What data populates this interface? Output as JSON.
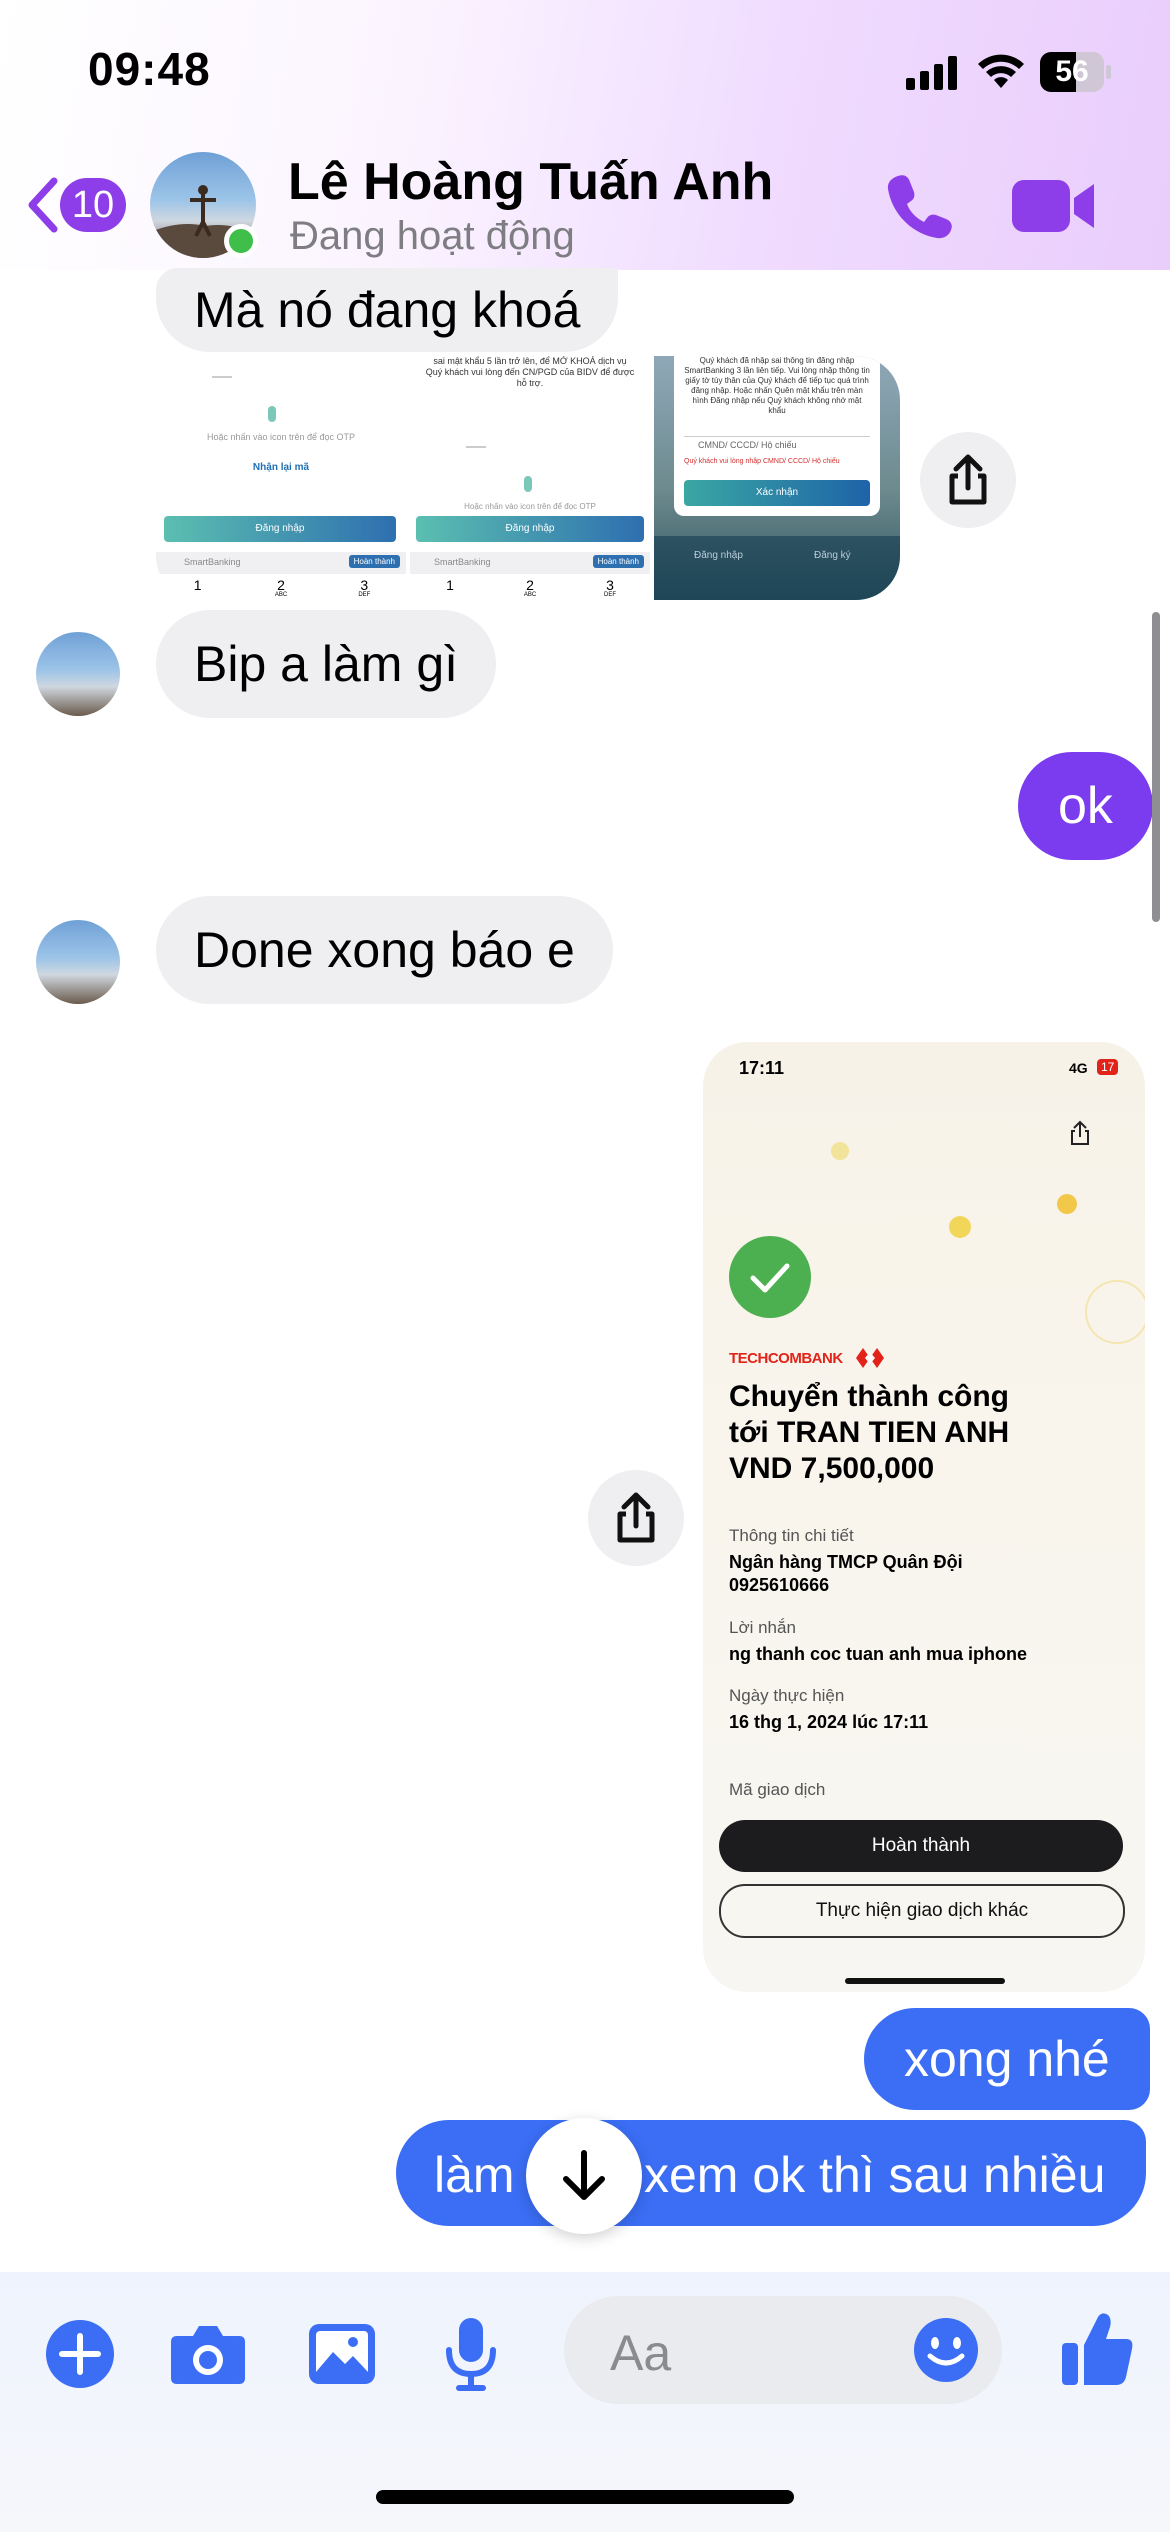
{
  "status_bar": {
    "time": "09:48",
    "battery": "56"
  },
  "header": {
    "back_count": "10",
    "contact_name": "Lê Hoàng Tuấn Anh",
    "presence": "Đang hoạt động",
    "accent_color": "#8e3ee8"
  },
  "messages": {
    "m1": "Mà nó đang khoá",
    "m2": "Bip a làm gì",
    "m3": "ok",
    "m4": "Done xong báo e",
    "m5": "xong nhé",
    "m6_part1": "làm",
    "m6_part2": "xem ok thì sau nhiều"
  },
  "screenshot_thumbs": {
    "t1": {
      "otp_hint": "Hoặc nhấn vào icon trên để đọc OTP",
      "resend": "Nhận lại mã",
      "login": "Đăng nhập",
      "smartbanking": "SmartBanking",
      "done": "Hoàn thành",
      "keys": [
        "1",
        "2",
        "3"
      ],
      "key_letters": [
        "",
        "ABC",
        "DEF"
      ]
    },
    "t2": {
      "notice": "sai mật khẩu 5 lần trở lên, để MỞ KHOÁ dịch vụ Quý khách vui lòng đến CN/PGD của BIDV để được hỗ trợ.",
      "otp_hint": "Hoặc nhấn vào icon trên để đọc OTP",
      "login": "Đăng nhập",
      "smartbanking": "SmartBanking",
      "done": "Hoàn thành",
      "keys": [
        "1",
        "2",
        "3"
      ],
      "key_letters": [
        "",
        "ABC",
        "DEF"
      ]
    },
    "t3": {
      "notice": "Quý khách đã nhập sai thông tin đăng nhập SmartBanking 3 lần liên tiếp. Vui lòng nhập thông tin giấy tờ tùy thân của Quý khách để tiếp tục quá trình đăng nhập. Hoặc nhấn Quên mật khẩu trên màn hình Đăng nhập nếu Quý khách không nhớ mật khẩu",
      "id_placeholder": "CMND/ CCCD/ Hộ chiếu",
      "error": "Quý khách vui lòng nhập CMND/ CCCD/ Hộ chiếu",
      "confirm": "Xác nhận",
      "login": "Đăng nhập",
      "register": "Đăng ký"
    }
  },
  "receipt": {
    "time": "17:11",
    "network": "4G",
    "battery": "17",
    "bank": "TECHCOMBANK",
    "headline": [
      "Chuyển thành công",
      "tới TRAN TIEN ANH",
      "VND 7,500,000"
    ],
    "details_label": "Thông tin chi tiết",
    "bank_name": "Ngân hàng TMCP Quân Đội",
    "account": "0925610666",
    "message_label": "Lời nhắn",
    "message": "ng thanh coc tuan anh mua iphone",
    "date_label": "Ngày thực hiện",
    "date": "16 thg 1, 2024 lúc 17:11",
    "txn_label": "Mã giao dịch",
    "done_button": "Hoàn thành",
    "other_button": "Thực hiện giao dịch khác"
  },
  "composer": {
    "placeholder": "Aa",
    "icons": [
      "plus-icon",
      "camera-icon",
      "gallery-icon",
      "microphone-icon",
      "emoji-icon",
      "thumbs-up-icon"
    ]
  },
  "colors": {
    "outgoing_blue": "#3b6ef5",
    "outgoing_purple": "#7b3cf0",
    "incoming_gray": "#efeff1",
    "online_green": "#3fbf4a",
    "techcombank_red": "#e2231a"
  }
}
